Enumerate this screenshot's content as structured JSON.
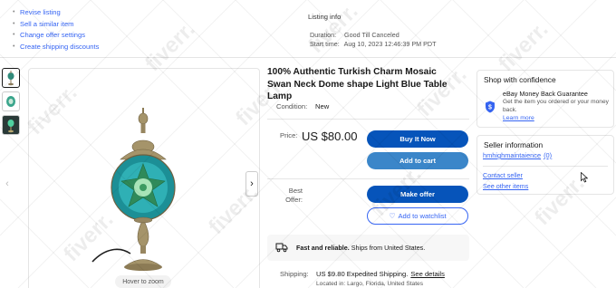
{
  "seller_tools": {
    "links": [
      "Revise listing",
      "Sell a similar item",
      "Change offer settings",
      "Create shipping discounts"
    ],
    "heading": "Listing info",
    "duration_label": "Duration:",
    "duration_value": "Good Till Canceled",
    "start_label": "Start time:",
    "start_value": "Aug 10, 2023 12:46:39 PM PDT"
  },
  "gallery": {
    "hover_label": "Hover to zoom"
  },
  "item": {
    "title": "100% Authentic Turkish Charm Mosaic Swan Neck Dome shape Light Blue Table Lamp",
    "condition_label": "Condition:",
    "condition_value": "New",
    "price_label": "Price:",
    "price_value": "US $80.00",
    "buy_label": "Buy It Now",
    "cart_label": "Add to cart",
    "best_offer_label": "Best Offer:",
    "offer_label": "Make offer",
    "watch_label": "Add to watchlist",
    "ship_banner_bold": "Fast and reliable.",
    "ship_banner_rest": " Ships from United States.",
    "shipping_label": "Shipping:",
    "shipping_value": "US $9.80 Expedited Shipping.",
    "shipping_link": "See details",
    "located": "Located in: Largo, Florida, United States"
  },
  "confidence": {
    "title": "Shop with confidence",
    "mbg_title": "eBay Money Back Guarantee",
    "mbg_desc": "Get the item you ordered or your money back.",
    "learn_more": "Learn more"
  },
  "seller": {
    "title": "Seller information",
    "name": "hmhighmaintaience",
    "count": "(0)",
    "contact": "Contact seller",
    "other_items": "See other items"
  },
  "watermark": "fiverr.",
  "icons": [
    "truck-icon",
    "shield-icon",
    "heart-icon",
    "chevron-left-icon",
    "chevron-right-icon"
  ],
  "colors": {
    "primary_blue": "#0654ba",
    "cart_blue": "#3b86c9",
    "link_blue": "#3665f3"
  }
}
